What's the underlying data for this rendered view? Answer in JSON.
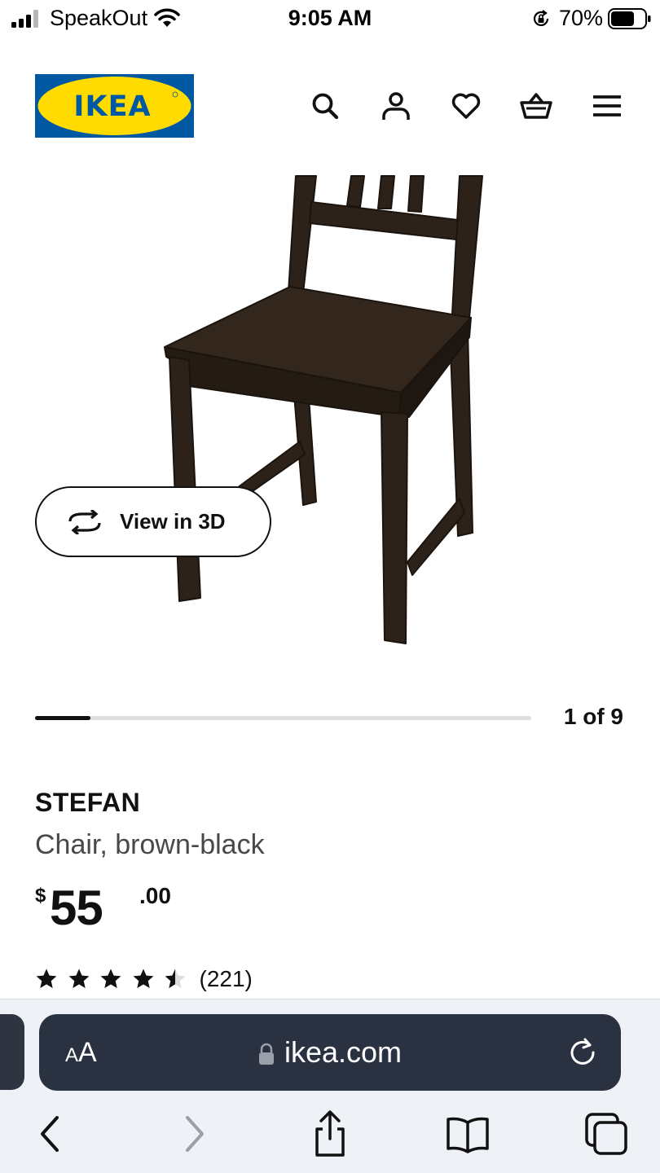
{
  "status_bar": {
    "carrier": "SpeakOut",
    "time": "9:05 AM",
    "battery_percent": "70%",
    "battery_level": 0.7,
    "icons": [
      "signal-icon",
      "wifi-icon",
      "orientation-lock-icon",
      "battery-icon"
    ]
  },
  "header": {
    "logo_text": "IKEA",
    "logo_colors": {
      "blue": "#0058A3",
      "yellow": "#FFDB00"
    },
    "icons": [
      "search-icon",
      "account-icon",
      "heart-icon",
      "basket-icon",
      "menu-icon"
    ]
  },
  "media": {
    "image_subject": "chair",
    "view_3d_label": "View in 3D",
    "carousel": {
      "current": 1,
      "total": 9,
      "counter_text": "1 of 9"
    }
  },
  "product": {
    "name": "STEFAN",
    "description": "Chair, brown-black",
    "price": {
      "currency": "$",
      "integer": "55",
      "decimal": ".00"
    },
    "rating": {
      "value": 4.5,
      "max": 5,
      "count_text": "(221)"
    }
  },
  "browser": {
    "aa_small": "A",
    "aa_big": "A",
    "url": "ikea.com",
    "bg_color": "#2A3140",
    "toolbar_icons": [
      "back-icon",
      "forward-icon",
      "share-icon",
      "bookmarks-icon",
      "tabs-icon"
    ]
  }
}
